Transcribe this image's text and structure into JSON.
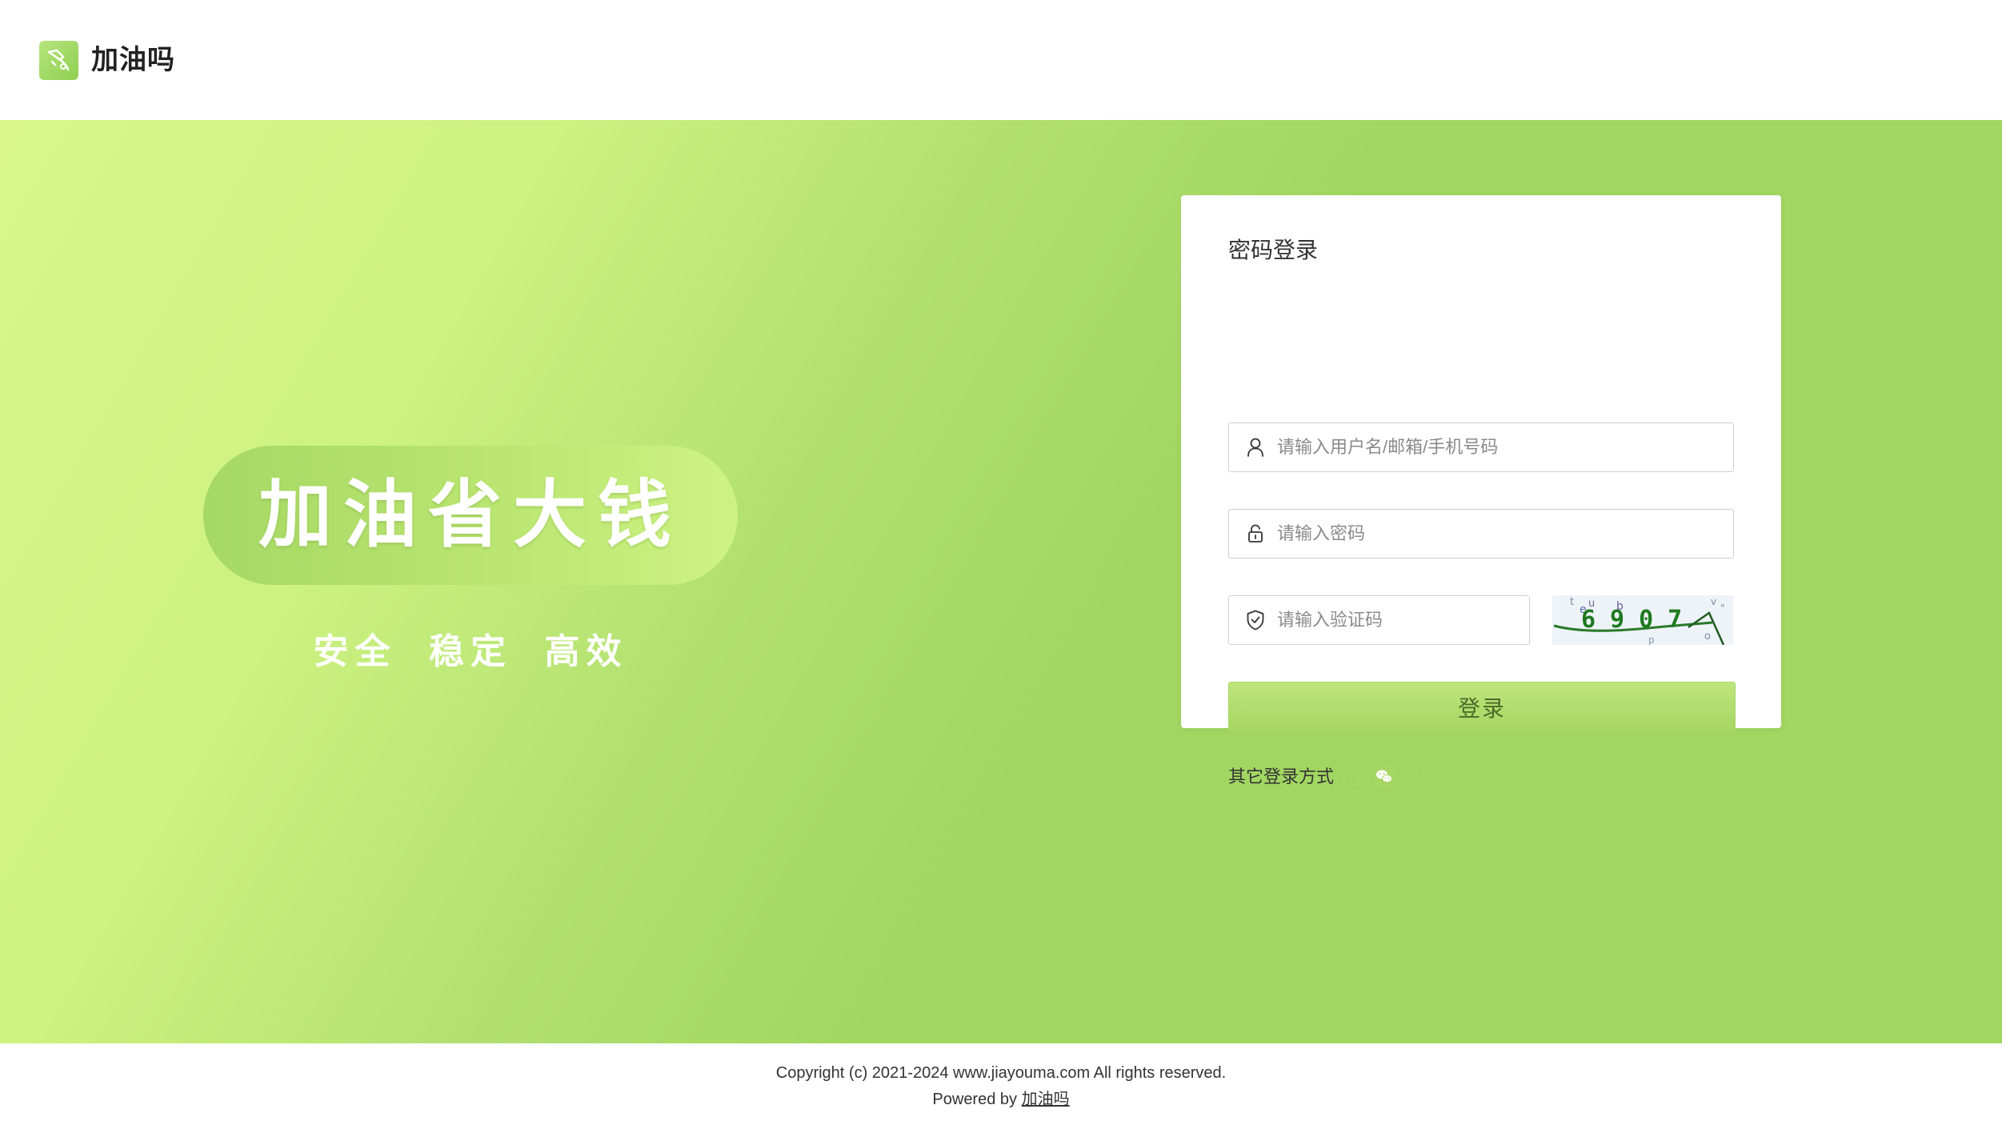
{
  "header": {
    "brand_name": "加油吗",
    "logo_icon": "fuel-nozzle-icon",
    "logo_color": "#a6d865"
  },
  "hero": {
    "slogan_title": "加油省大钱",
    "slogan_sub": "安全  稳定  高效",
    "gradient_light": "#d8f68c",
    "gradient_dark": "#a2d662"
  },
  "login": {
    "title": "密码登录",
    "username": {
      "placeholder": "请输入用户名/邮箱/手机号码",
      "value": "",
      "icon": "user-icon"
    },
    "password": {
      "placeholder": "请输入密码",
      "value": "",
      "icon": "lock-icon"
    },
    "captcha_field": {
      "placeholder": "请输入验证码",
      "value": "",
      "icon": "shield-check-icon"
    },
    "captcha_text": "6907",
    "submit_label": "登录",
    "other_methods_label": "其它登录方式",
    "other_methods": [
      {
        "icon": "lock-icon",
        "name": "password-login"
      },
      {
        "icon": "wechat-icon",
        "name": "wechat-login"
      },
      {
        "icon": "mobile-phone-icon",
        "name": "phone-login"
      }
    ],
    "accent_color": "#a6d663"
  },
  "footer": {
    "copyright": "Copyright (c) 2021-2024 www.jiayouma.com All rights reserved.",
    "powered_prefix": "Powered by ",
    "powered_link": "加油吗"
  }
}
